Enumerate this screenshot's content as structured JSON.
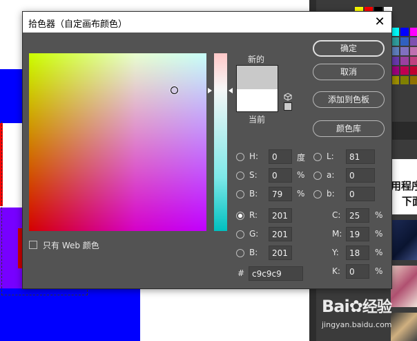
{
  "dialog": {
    "title": "拾色器（自定画布颜色）",
    "close_glyph": "✕"
  },
  "preview": {
    "new_label": "新的",
    "current_label": "当前",
    "new_color": "#c9c9c9",
    "current_color": "#ffffff"
  },
  "buttons": {
    "ok": "确定",
    "cancel": "取消",
    "add_to_swatches": "添加到色板",
    "color_libraries": "颜色库"
  },
  "hsb": {
    "h_label": "H:",
    "h_value": "0",
    "h_unit": "度",
    "s_label": "S:",
    "s_value": "0",
    "s_unit": "%",
    "b_label": "B:",
    "b_value": "79",
    "b_unit": "%"
  },
  "lab": {
    "l_label": "L:",
    "l_value": "81",
    "a_label": "a:",
    "a_value": "0",
    "b_label": "b:",
    "b_value": "0"
  },
  "rgb": {
    "r_label": "R:",
    "r_value": "201",
    "g_label": "G:",
    "g_value": "201",
    "b_label": "B:",
    "b_value": "201",
    "selected": "R"
  },
  "cmyk": {
    "c_label": "C:",
    "c_value": "25",
    "m_label": "M:",
    "m_value": "19",
    "y_label": "Y:",
    "y_value": "18",
    "k_label": "K:",
    "k_value": "0",
    "unit": "%"
  },
  "hex": {
    "label": "#",
    "value": "c9c9c9"
  },
  "web_only": {
    "label": "只有 Web 颜色",
    "checked": false
  },
  "background": {
    "promo_text_line1": "用程序",
    "promo_text_line2": "下面",
    "watermark_logo_a": "Bai",
    "watermark_logo_b": "经验",
    "watermark_url": "jingyan.baidu.com"
  },
  "icons": {
    "gamut_warning": "cube-icon",
    "close": "close-icon"
  }
}
